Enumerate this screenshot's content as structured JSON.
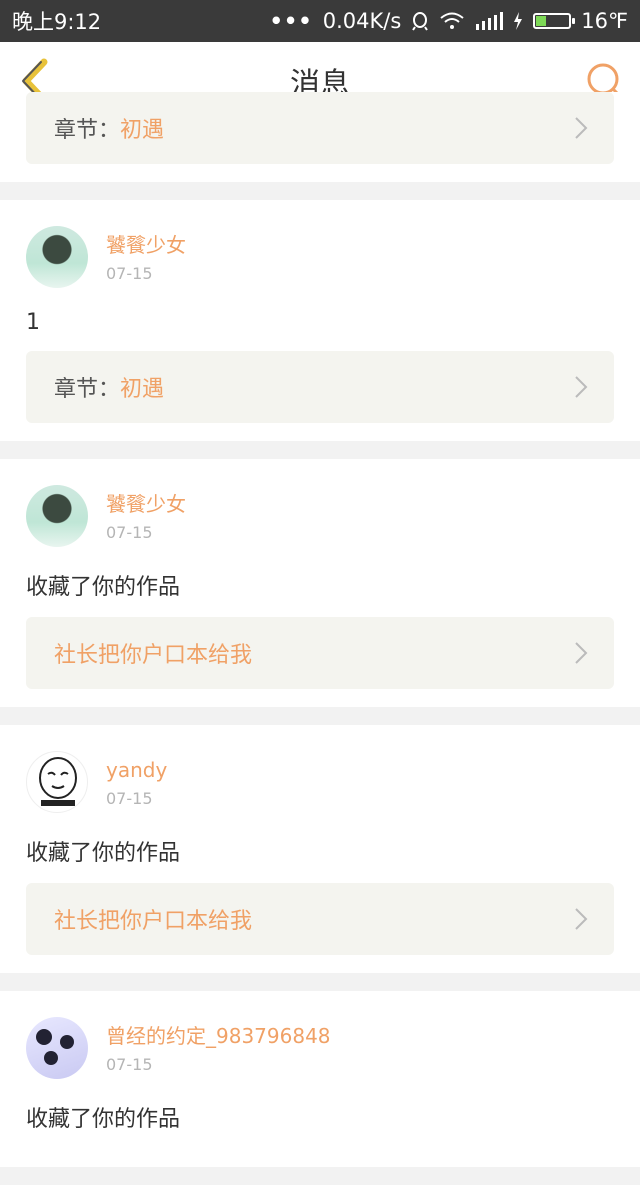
{
  "status_bar": {
    "time": "晚上9:12",
    "dots": "•••",
    "speed": "0.04K/s",
    "temp": "16℉"
  },
  "header": {
    "title": "消息"
  },
  "items": [
    {
      "ref_label": "章节：",
      "ref_value": "初遇"
    },
    {
      "username": "饕餮少女",
      "date": "07-15",
      "content": "1",
      "ref_label": "章节：",
      "ref_value": "初遇"
    },
    {
      "username": "饕餮少女",
      "date": "07-15",
      "content": "收藏了你的作品",
      "ref_value": "社长把你户口本给我"
    },
    {
      "username": "yandy",
      "date": "07-15",
      "content": "收藏了你的作品",
      "ref_value": "社长把你户口本给我"
    },
    {
      "username": "曾经的约定_983796848",
      "date": "07-15",
      "content": "收藏了你的作品"
    }
  ],
  "colors": {
    "accent": "#f0a166",
    "ref_bg": "#f4f4ef"
  }
}
